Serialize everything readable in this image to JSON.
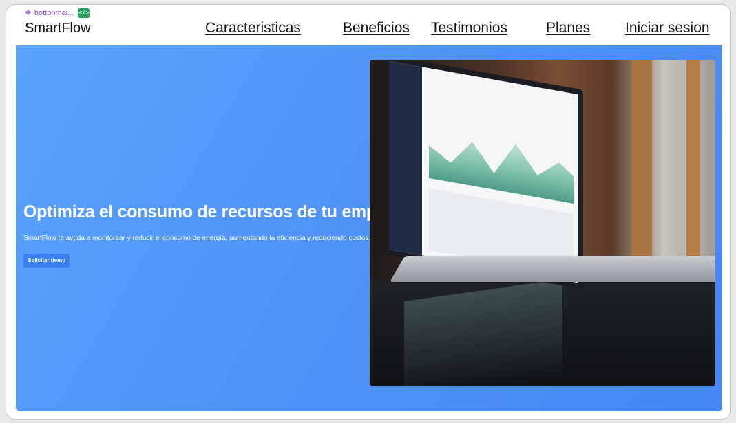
{
  "component_tag": {
    "label": "bottonmai...",
    "badge": "</>"
  },
  "nav": {
    "brand": "SmartFlow",
    "links": [
      "Caracteristicas",
      "Beneficios",
      "Testimonios",
      "Planes",
      "Iniciar sesion"
    ]
  },
  "hero": {
    "title": "Optimiza el consumo de recursos de tu empresa",
    "subtitle": "SmartFlow te ayuda a monitorear y reducir el consumo de energía, aumentando la eficiencia y reduciendo costos.",
    "cta_label": "Solicitar demo"
  },
  "colors": {
    "hero_gradient_start": "#5aa3fb",
    "hero_gradient_end": "#4587f3",
    "cta_background": "#3b7ff0",
    "component_tag": "#8a4be0",
    "code_badge": "#22a05b"
  }
}
